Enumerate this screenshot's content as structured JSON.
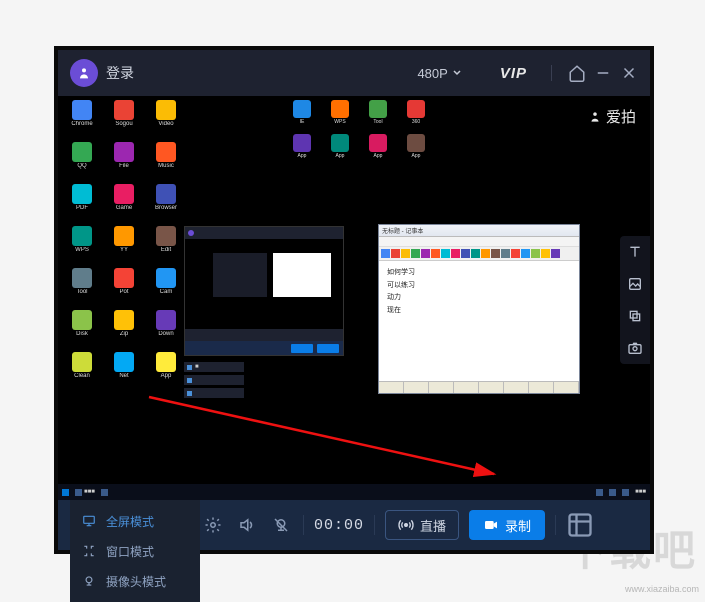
{
  "titlebar": {
    "login": "登录",
    "resolution": "480P",
    "vip": "VIP"
  },
  "watermark": {
    "brand": "爱拍"
  },
  "timer": "00:00",
  "live_label": "直播",
  "record_label": "录制",
  "mode": {
    "current": "全屏模式",
    "options": [
      "全屏模式",
      "窗口模式",
      "摄像头模式"
    ]
  },
  "desktop_apps": [
    "Chrome",
    "Sogou",
    "Video",
    "QQ",
    "File",
    "Music",
    "PDF",
    "Game",
    "Browser",
    "WPS",
    "YY",
    "Edit",
    "Tool",
    "Pot",
    "Cam",
    "Disk",
    "Zip",
    "Down",
    "Clean",
    "Net",
    "App"
  ],
  "top_apps": [
    "IE",
    "WPS",
    "Tool",
    "360"
  ],
  "notepad": {
    "title": "无标题 - 记事本",
    "lines": [
      "如何学习",
      "可以练习",
      "动力",
      "现在"
    ]
  },
  "page_wm": {
    "big": "下载吧",
    "site": "www.xiazaiba.com"
  }
}
